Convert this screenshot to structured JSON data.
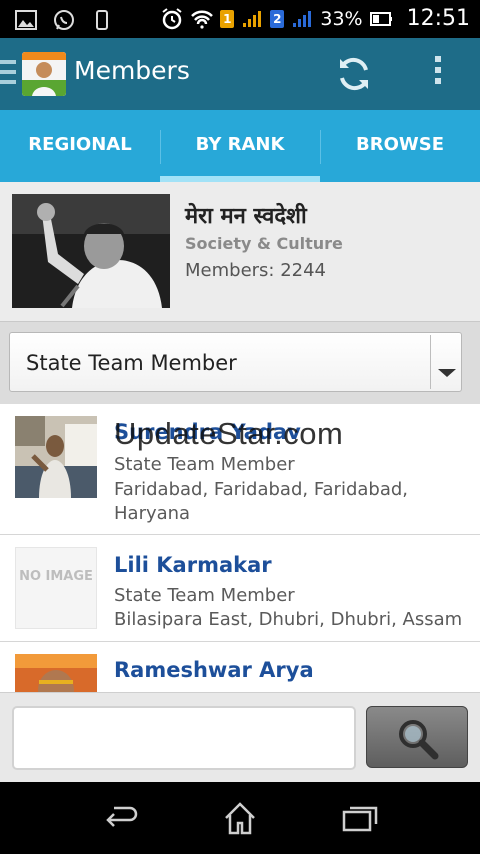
{
  "status_bar": {
    "sim1_label": "1",
    "sim2_label": "2",
    "battery_percent": "33%",
    "time": "12:51"
  },
  "action_bar": {
    "title": "Members"
  },
  "tabs": [
    {
      "label": "REGIONAL",
      "active": false
    },
    {
      "label": "BY RANK",
      "active": true
    },
    {
      "label": "BROWSE",
      "active": false
    }
  ],
  "group": {
    "name": "मेरा मन स्वदेशी",
    "category": "Society & Culture",
    "members": "Members: 2244"
  },
  "filter": {
    "selected": "State Team Member"
  },
  "watermark": "UpdateStar.com",
  "members": [
    {
      "name": "Surendra Yadav",
      "rank": "State Team Member",
      "location": "Faridabad, Faridabad, Faridabad, Haryana",
      "has_photo": true
    },
    {
      "name": "Lili Karmakar",
      "rank": "State Team Member",
      "location": "Bilasipara East, Dhubri, Dhubri, Assam",
      "has_photo": false,
      "placeholder_text": "NO IMAGE"
    },
    {
      "name": "Rameshwar Arya",
      "rank": "",
      "location": "",
      "has_photo": true
    }
  ],
  "search": {
    "value": "",
    "placeholder": ""
  },
  "colors": {
    "action_bar": "#1e6c88",
    "tab_bar": "#28a8d8",
    "tab_indicator": "#a2e2f7",
    "member_name": "#1d4f9a"
  }
}
